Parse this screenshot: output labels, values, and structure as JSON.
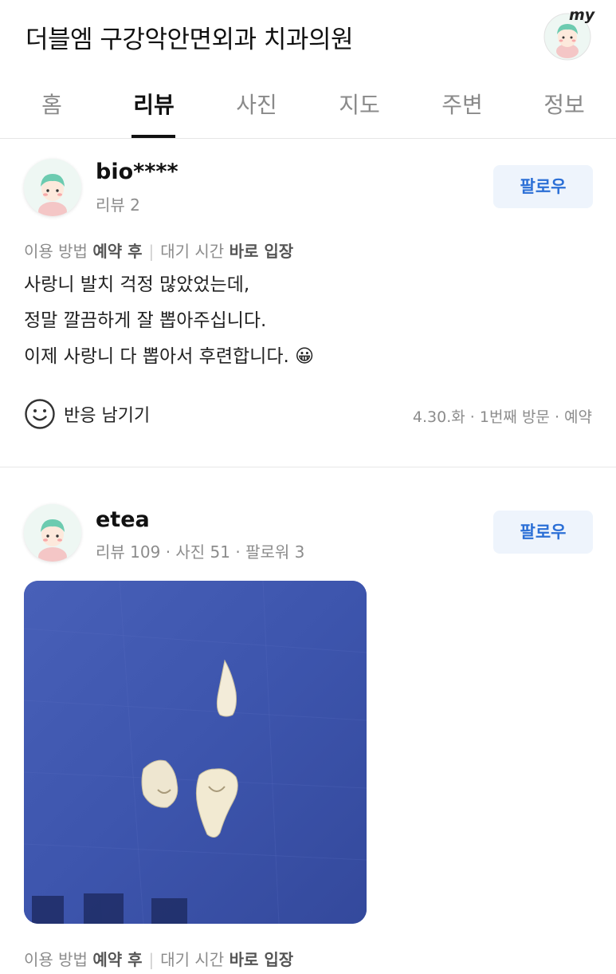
{
  "header": {
    "title": "더블엠 구강악안면외과 치과의원",
    "my_badge": "my"
  },
  "tabs": [
    {
      "label": "홈"
    },
    {
      "label": "리뷰"
    },
    {
      "label": "사진"
    },
    {
      "label": "지도"
    },
    {
      "label": "주변"
    },
    {
      "label": "정보"
    }
  ],
  "reviews": [
    {
      "author": "bio****",
      "stats": "리뷰 2",
      "follow_label": "팔로우",
      "visit": {
        "method_label": "이용 방법",
        "method_value": "예약 후",
        "wait_label": "대기 시간",
        "wait_value": "바로 입장"
      },
      "body": [
        "사랑니 발치 걱정 많았었는데,",
        "정말 깔끔하게 잘 뽑아주십니다.",
        "이제 사랑니 다 뽑아서 후련합니다. 😀"
      ],
      "react_label": "반응 남기기",
      "date_info": "4.30.화 · 1번째 방문 · 예약"
    },
    {
      "author": "etea",
      "stats": "리뷰 109 · 사진 51 · 팔로워 3",
      "follow_label": "팔로우",
      "visit": {
        "method_label": "이용 방법",
        "method_value": "예약 후",
        "wait_label": "대기 시간",
        "wait_value": "바로 입장"
      }
    }
  ],
  "colors": {
    "accent": "#2b6fd6",
    "follow_bg": "#eef4fc",
    "muted": "#8c8c8c",
    "photo_bg": "#3f57b0"
  }
}
